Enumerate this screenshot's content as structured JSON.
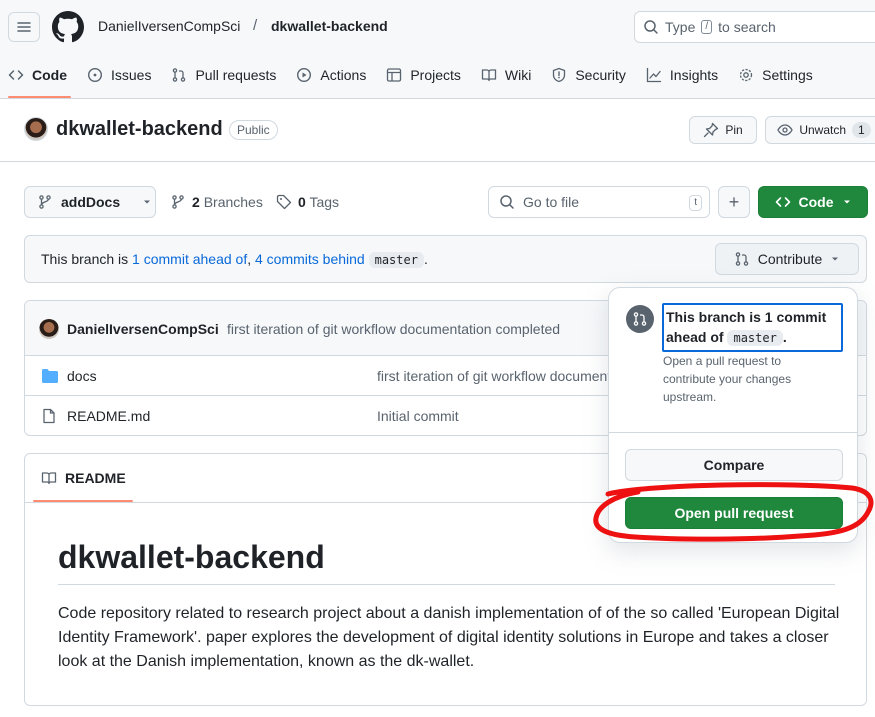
{
  "header": {
    "owner": "DanielIversenCompSci",
    "separator": "/",
    "repo": "dkwallet-backend",
    "search_placeholder_pre": "Type",
    "search_key": "/",
    "search_placeholder_post": "to search"
  },
  "tabs": [
    {
      "label": "Code",
      "icon": "code-icon",
      "active": true
    },
    {
      "label": "Issues",
      "icon": "issue-icon"
    },
    {
      "label": "Pull requests",
      "icon": "pull-request-icon"
    },
    {
      "label": "Actions",
      "icon": "play-icon"
    },
    {
      "label": "Projects",
      "icon": "table-icon"
    },
    {
      "label": "Wiki",
      "icon": "book-icon"
    },
    {
      "label": "Security",
      "icon": "shield-icon"
    },
    {
      "label": "Insights",
      "icon": "graph-icon"
    },
    {
      "label": "Settings",
      "icon": "gear-icon"
    }
  ],
  "repo_header": {
    "title": "dkwallet-backend",
    "visibility": "Public",
    "pin_label": "Pin",
    "unwatch_label": "Unwatch",
    "watch_count": "1"
  },
  "branch_bar": {
    "branch_name": "addDocs",
    "branches_count": "2",
    "branches_label": "Branches",
    "tags_count": "0",
    "tags_label": "Tags",
    "goto_placeholder": "Go to file",
    "goto_key": "t",
    "add_label": "+",
    "code_label": "Code"
  },
  "branch_info": {
    "prefix": "This branch is ",
    "ahead": "1 commit ahead of",
    "comma": ", ",
    "behind": "4 commits behind",
    "base": "master",
    "suffix": ".",
    "contribute_label": "Contribute"
  },
  "latest_commit": {
    "author": "DanielIversenCompSci",
    "message": "first iteration of git workflow documentation completed"
  },
  "files": [
    {
      "name": "docs",
      "type": "folder",
      "message": "first iteration of git workflow documentation completed"
    },
    {
      "name": "README.md",
      "type": "file",
      "message": "Initial commit"
    }
  ],
  "readme": {
    "tab_label": "README",
    "heading": "dkwallet-backend",
    "body": "Code repository related to research project about a danish implementation of of the so called 'European Digital Identity Framework'. paper explores the development of digital identity solutions in Europe and takes a closer look at the Danish implementation, known as the dk-wallet."
  },
  "popover": {
    "title_pre": "This branch is 1 commit ahead of ",
    "title_base": "master",
    "title_post": ".",
    "description": "Open a pull request to contribute your changes upstream.",
    "compare_label": "Compare",
    "open_pr_label": "Open pull request"
  },
  "colors": {
    "primary_green": "#1f883d",
    "link_blue": "#0969da",
    "annotation_red": "#ee1111",
    "active_tab_underline": "#fd8c73"
  }
}
